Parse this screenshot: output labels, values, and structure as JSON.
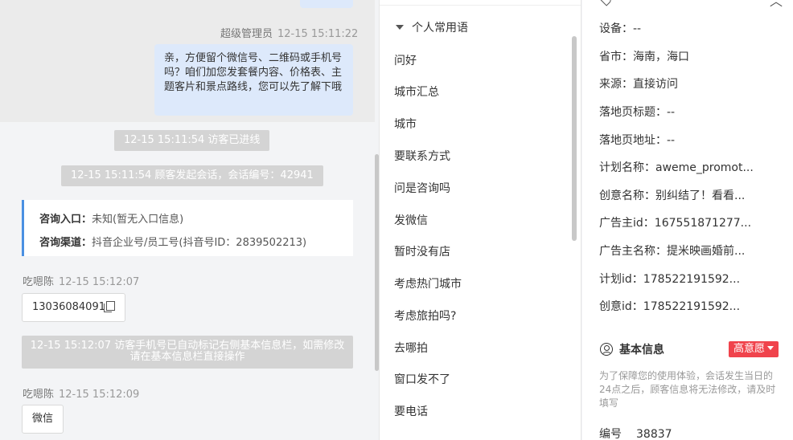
{
  "chat": {
    "msg1": {
      "sender": "超级管理员",
      "time": "12-15 15:11:22",
      "text": "亲，方便留个微信号、二维码或手机号吗？咱们加您发套餐内容、价格表、主题客片和景点路线，您可以先了解下哦"
    },
    "sys1": "12-15 15:11:54 访客已进线",
    "sys2": "12-15 15:11:54 顾客发起会话，会话编号：42941",
    "card": {
      "entry_label": "咨询入口：",
      "entry_value": "未知(暂无入口信息)",
      "channel_label": "咨询渠道：",
      "channel_value": "抖音企业号/员工号(抖音号ID：2839502213)"
    },
    "msg2": {
      "sender": "吃嗯陈",
      "time": "12-15 15:12:07",
      "text": "13036084091"
    },
    "sys3": "12-15 15:12:07 访客手机号已自动标记右侧基本信息栏，如需修改请在基本信息栏直接操作",
    "msg3": {
      "sender": "吃嗯陈",
      "time": "12-15 15:12:09",
      "text": "微信"
    }
  },
  "phrases": {
    "group": "个人常用语",
    "items": [
      "问好",
      "城市汇总",
      "城市",
      "要联系方式",
      "问是咨询吗",
      "发微信",
      "暂时没有店",
      "考虑热门城市",
      "考虑旅拍吗?",
      "去哪拍",
      "窗口发不了",
      "要电话"
    ]
  },
  "info": {
    "fields": [
      {
        "label": "设备：",
        "value": "--"
      },
      {
        "label": "省市：",
        "value": "海南，海口"
      },
      {
        "label": "来源：",
        "value": "直接访问"
      },
      {
        "label": "落地页标题：",
        "value": "--"
      },
      {
        "label": "落地页地址：",
        "value": "--"
      },
      {
        "label": "计划名称：",
        "value": "aweme_promot..."
      },
      {
        "label": "创意名称：",
        "value": "别纠结了！看看..."
      },
      {
        "label": "广告主id：",
        "value": "167551871277..."
      },
      {
        "label": "广告主名称：",
        "value": "提米映画婚前..."
      },
      {
        "label": "计划id：",
        "value": "178522191592..."
      },
      {
        "label": "创意id：",
        "value": "178522191592..."
      }
    ],
    "basic_title": "基本信息",
    "intent_badge": "高意愿",
    "notice": "为了保障您的使用体验，会话发生当日的24点之后，顾客信息将无法修改，请及时填写",
    "id_label": "编号",
    "id_value": "38837"
  }
}
